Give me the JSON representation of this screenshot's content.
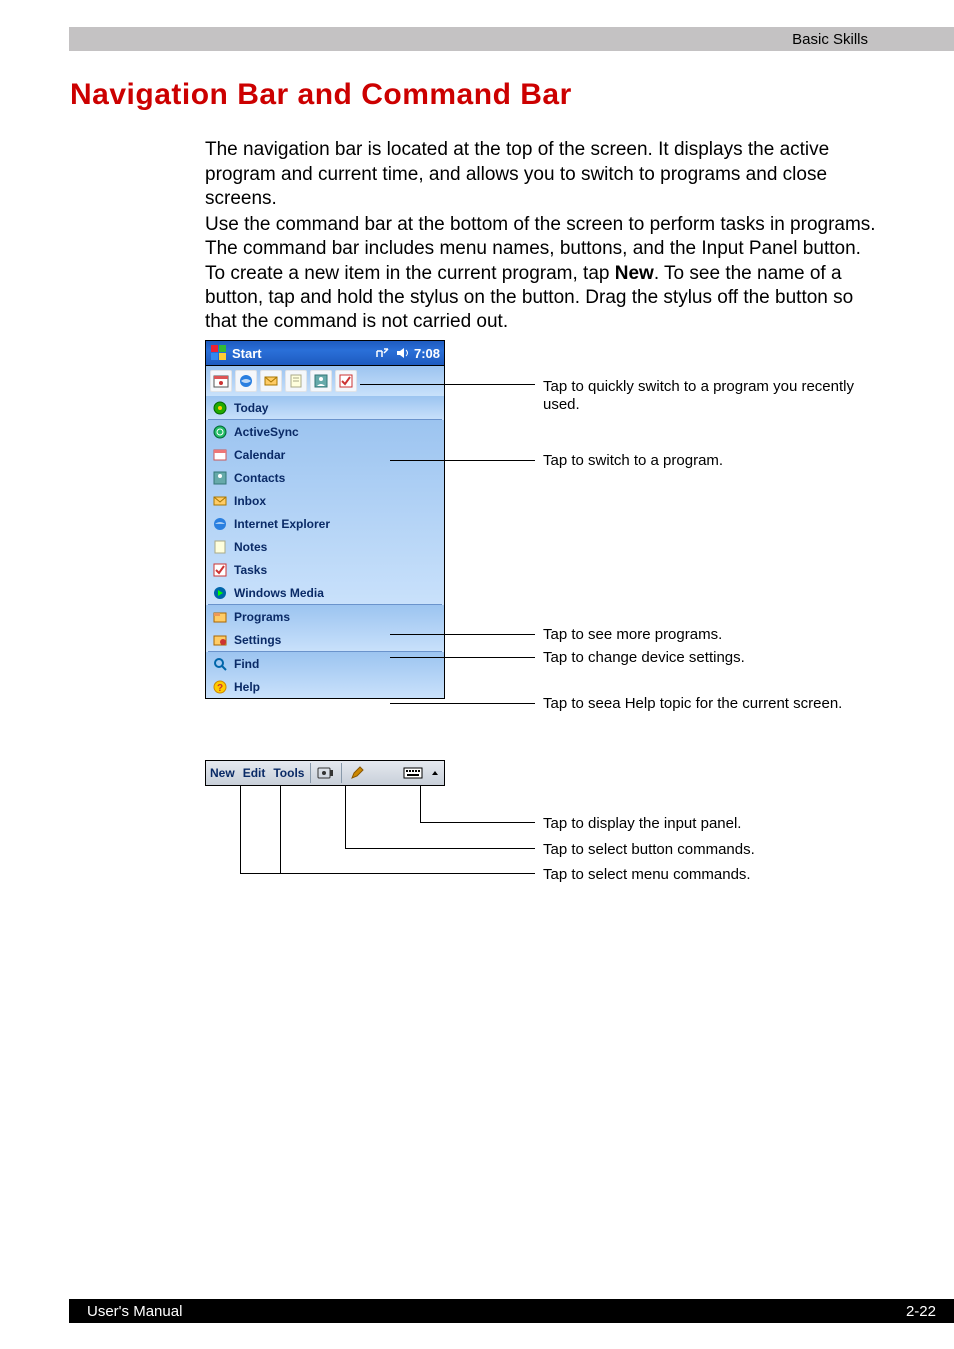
{
  "header": {
    "chapter": "Basic Skills"
  },
  "heading": "Navigation Bar and Command Bar",
  "paragraph1": "The navigation bar is located at the top of the screen. It displays the active program and current time, and allows you to switch to programs and close screens.",
  "paragraph2_a": "Use the command bar at the bottom of the screen to perform tasks in programs. The command bar includes menu names, buttons, and the Input Panel button. To create a new item in the current program, tap ",
  "paragraph2_bold": "New",
  "paragraph2_b": ". To see the name of a button, tap and hold the stylus on the button. Drag the stylus off the button so that the command is not carried out.",
  "navbar": {
    "title": "Start",
    "time": "7:08"
  },
  "recent_icons": [
    "calendar-icon",
    "ie-icon",
    "inbox-icon",
    "notes-icon",
    "contacts-icon",
    "tasks-icon"
  ],
  "menu": {
    "today": "Today",
    "items": [
      "ActiveSync",
      "Calendar",
      "Contacts",
      "Inbox",
      "Internet Explorer",
      "Notes",
      "Tasks",
      "Windows Media"
    ],
    "programs": "Programs",
    "settings": "Settings",
    "find": "Find",
    "help": "Help"
  },
  "cmdbar": {
    "new": "New",
    "edit": "Edit",
    "tools": "Tools"
  },
  "callouts": {
    "recent": "Tap to quickly switch to a program you recently used.",
    "switch": "Tap to switch to a program.",
    "programs": "Tap to see more programs.",
    "settings": "Tap to change device settings.",
    "help": "Tap to seea Help topic for the current screen.",
    "input_panel": "Tap to display the input panel.",
    "button_cmds": "Tap to select button commands.",
    "menu_cmds": "Tap to select menu commands."
  },
  "footer": {
    "left": "User's Manual",
    "right": "2-22"
  }
}
